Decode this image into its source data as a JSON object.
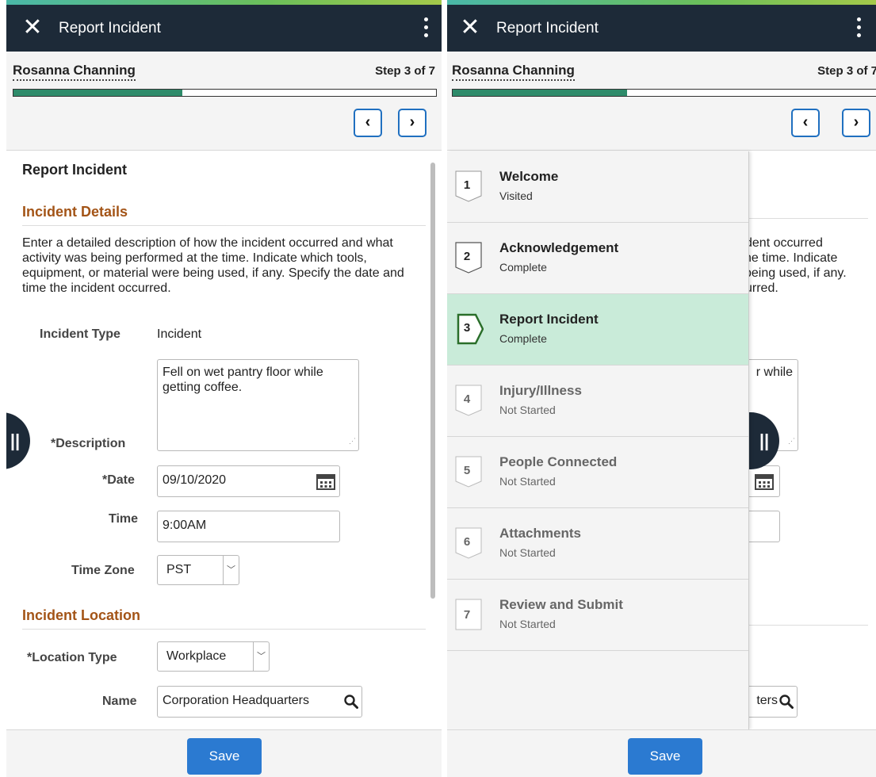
{
  "left": {
    "topbar": {
      "title": "Report Incident",
      "close_icon": "close-icon",
      "menu_icon": "kebab-menu-icon"
    },
    "header": {
      "person": "Rosanna Channing",
      "step": "Step 3 of 7",
      "progress": 0.4,
      "prev": "‹",
      "next": "›"
    },
    "content": {
      "page_title": "Report Incident",
      "section_details": "Incident Details",
      "description": "Enter a detailed description of how the incident occurred and what activity was being performed at the time. Indicate which tools, equipment, or material were being used, if any. Specify the date and time the incident occurred.",
      "fields": {
        "incident_type_label": "Incident Type",
        "incident_type_value": "Incident",
        "description_label": "*Description",
        "description_value": "Fell on wet pantry floor while getting coffee.",
        "date_label": "*Date",
        "date_value": "09/10/2020",
        "time_label": "Time",
        "time_value": "9:00AM",
        "timezone_label": "Time Zone",
        "timezone_value": "PST"
      },
      "section_location": "Incident Location",
      "location": {
        "type_label": "*Location Type",
        "type_value": "Workplace",
        "name_label": "Name",
        "name_value": "Corporation Headquarters"
      }
    },
    "footer": {
      "save": "Save"
    }
  },
  "right": {
    "topbar": {
      "title": "Report Incident"
    },
    "header": {
      "person": "Rosanna Channing",
      "step": "Step 3 of 7",
      "progress": 0.4
    },
    "partial_text": [
      "dent occurred",
      "he time. Indicate",
      "peing used, if any.",
      "urred.",
      "r while",
      "ters"
    ],
    "steps": [
      {
        "num": "1",
        "name": "Welcome",
        "status": "Visited"
      },
      {
        "num": "2",
        "name": "Acknowledgement",
        "status": "Complete"
      },
      {
        "num": "3",
        "name": "Report Incident",
        "status": "Complete"
      },
      {
        "num": "4",
        "name": "Injury/Illness",
        "status": "Not Started"
      },
      {
        "num": "5",
        "name": "People Connected",
        "status": "Not Started"
      },
      {
        "num": "6",
        "name": "Attachments",
        "status": "Not Started"
      },
      {
        "num": "7",
        "name": "Review and Submit",
        "status": "Not Started"
      }
    ],
    "footer": {
      "save": "Save"
    }
  },
  "colors": {
    "topbar": "#1d2a38",
    "accent": "#2b7ad1",
    "progress": "#2e8b6a",
    "section": "#a35417",
    "active_step": "#c9ebd9"
  }
}
